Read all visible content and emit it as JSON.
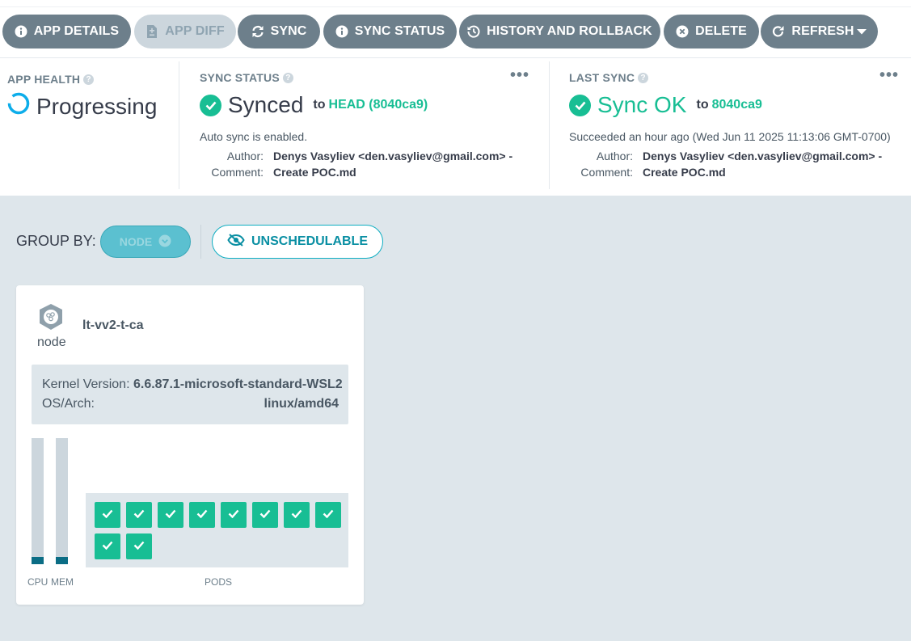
{
  "toolbar": {
    "buttons": [
      {
        "label": "APP DETAILS",
        "icon": "info-circle-icon"
      },
      {
        "label": "APP DIFF",
        "icon": "file-diff-icon",
        "disabled": true
      },
      {
        "label": "SYNC",
        "icon": "sync-icon"
      },
      {
        "label": "SYNC STATUS",
        "icon": "info-circle-icon"
      },
      {
        "label": "HISTORY AND ROLLBACK",
        "icon": "history-icon"
      },
      {
        "label": "DELETE",
        "icon": "times-circle-icon"
      },
      {
        "label": "REFRESH",
        "icon": "redo-icon",
        "dropdown": true
      }
    ]
  },
  "app_health": {
    "title": "APP HEALTH",
    "status": "Progressing"
  },
  "sync_status": {
    "title": "SYNC STATUS",
    "status": "Synced",
    "to": "to",
    "revision": "HEAD (8040ca9)",
    "auto_sync": "Auto sync is enabled.",
    "author_label": "Author:",
    "author": "Denys Vasyliev <den.vasyliev@gmail.com> -",
    "comment_label": "Comment:",
    "comment": "Create POC.md"
  },
  "last_sync": {
    "title": "LAST SYNC",
    "status": "Sync OK",
    "to": "to",
    "revision": "8040ca9",
    "succeeded": "Succeeded an hour ago (Wed Jun 11 2025 11:13:06 GMT-0700)",
    "author_label": "Author:",
    "author": "Denys Vasyliev <den.vasyliev@gmail.com> -",
    "comment_label": "Comment:",
    "comment": "Create POC.md"
  },
  "group_by": {
    "label": "GROUP BY:",
    "node_pill": "NODE",
    "unschedulable": "UNSCHEDULABLE"
  },
  "node_card": {
    "name": "lt-vv2-t-ca",
    "kind": "node",
    "kernel_label": "Kernel Version:",
    "kernel_value": "6.6.87.1-microsoft-standard-WSL2",
    "os_label": "OS/Arch:",
    "os_value": "linux/amd64",
    "cpu_label": "CPU",
    "mem_label": "MEM",
    "cpu_usage_fraction": 0.06,
    "mem_usage_fraction": 0.06,
    "pods_label": "PODS",
    "pod_count": 10,
    "pod_status": "healthy"
  },
  "colors": {
    "toolbar_button": "#6d7f8b",
    "healthy": "#18be94",
    "progressing": "#0dadea",
    "accent": "#0dadc1",
    "background": "#dee6eb"
  }
}
